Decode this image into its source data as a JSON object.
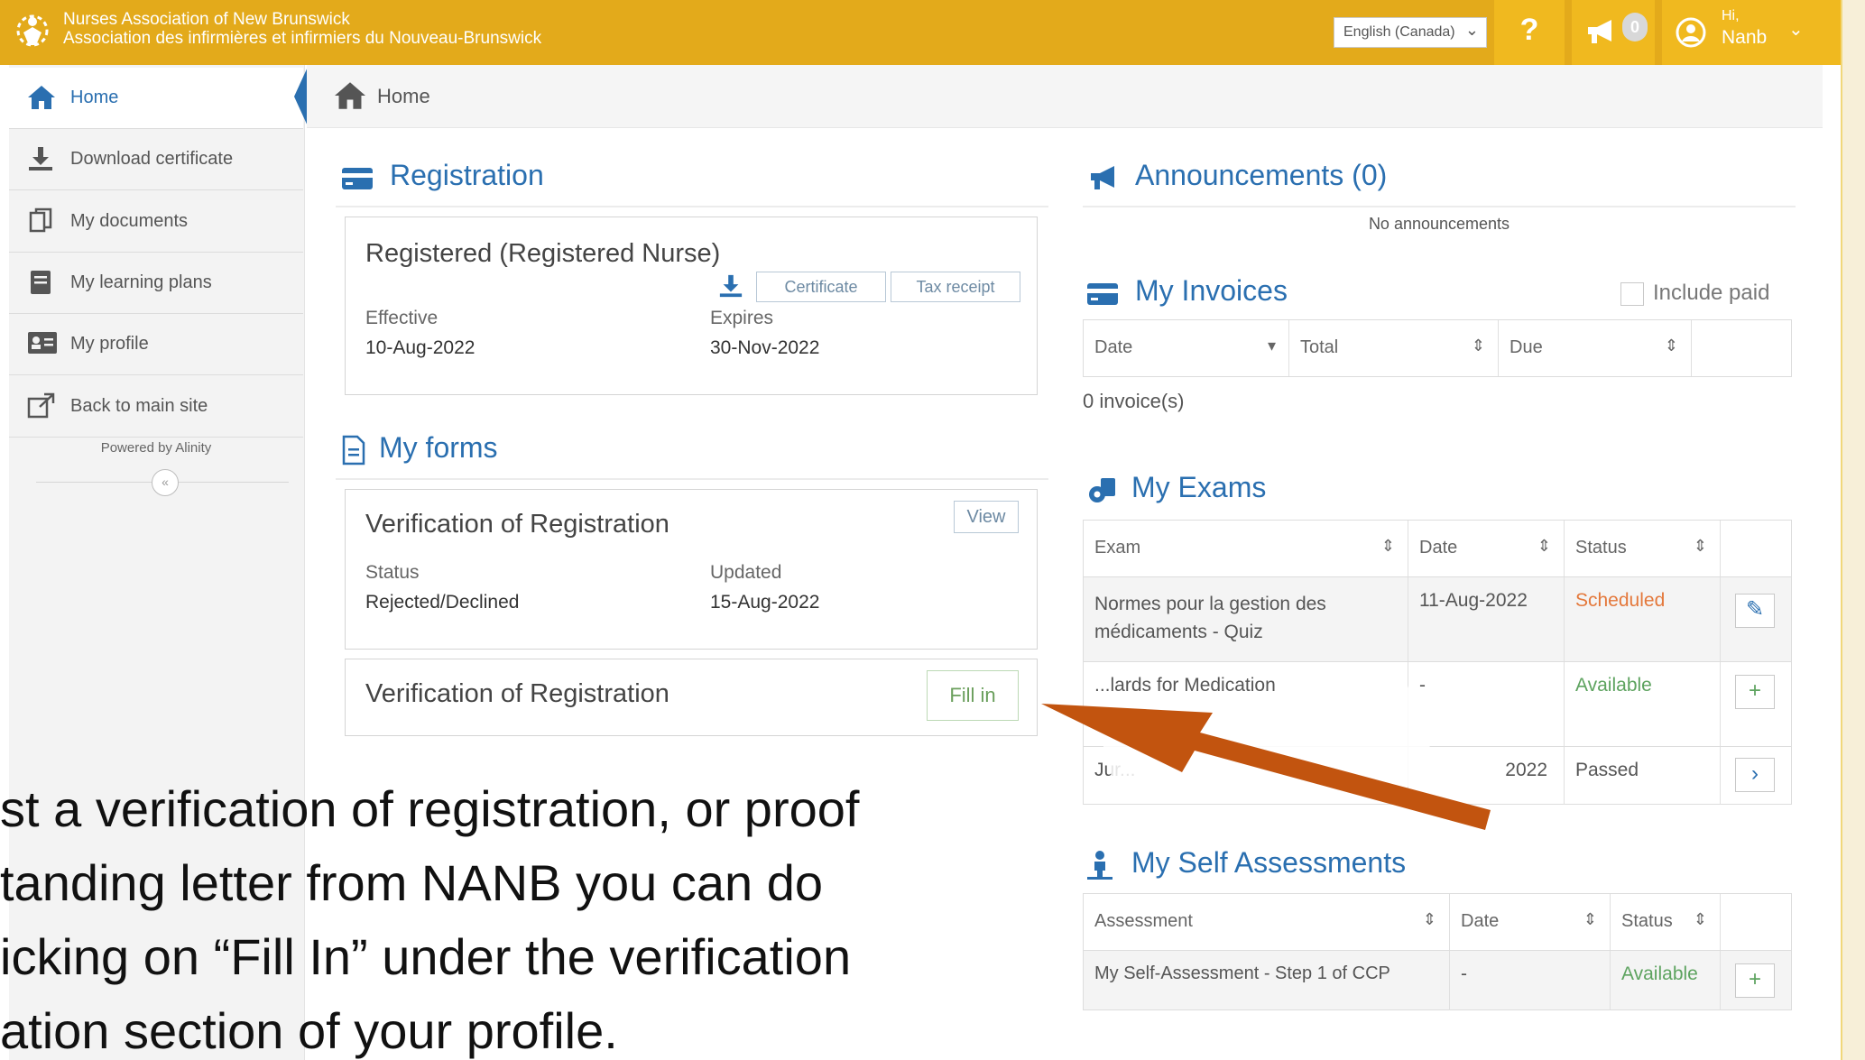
{
  "topbar": {
    "org_name_en": "Nurses Association of New Brunswick",
    "org_name_fr": "Association des infirmières et infirmiers du Nouveau-Brunswick",
    "language": "English (Canada)",
    "help_label": "?",
    "announcement_count": "0",
    "user_greeting": "Hi,",
    "user_name": "Nanb",
    "accent_color": "#e3aa1b"
  },
  "sidebar": {
    "items": [
      {
        "label": "Home",
        "icon": "home-icon"
      },
      {
        "label": "Download certificate",
        "icon": "download-icon"
      },
      {
        "label": "My documents",
        "icon": "documents-icon"
      },
      {
        "label": "My learning plans",
        "icon": "learning-plans-icon"
      },
      {
        "label": "My profile",
        "icon": "profile-card-icon"
      },
      {
        "label": "Back to main site",
        "icon": "external-link-icon"
      }
    ],
    "powered_by": "Powered by Alinity",
    "collapse_label": "«"
  },
  "breadcrumb": {
    "label": "Home"
  },
  "registration": {
    "heading": "Registration",
    "status_title": "Registered (Registered Nurse)",
    "certificate_button": "Certificate",
    "tax_receipt_button": "Tax receipt",
    "effective_label": "Effective",
    "effective_value": "10-Aug-2022",
    "expires_label": "Expires",
    "expires_value": "30-Nov-2022"
  },
  "forms": {
    "heading": "My forms",
    "items": [
      {
        "title": "Verification of Registration",
        "button": "View",
        "status_label": "Status",
        "status_value": "Rejected/Declined",
        "updated_label": "Updated",
        "updated_value": "15-Aug-2022"
      },
      {
        "title": "Verification of Registration",
        "button": "Fill in"
      }
    ]
  },
  "announcements": {
    "heading": "Announcements (0)",
    "empty_text": "No announcements"
  },
  "invoices": {
    "heading": "My Invoices",
    "include_paid_label": "Include paid",
    "columns": [
      "Date",
      "Total",
      "Due"
    ],
    "count_text": "0 invoice(s)"
  },
  "exams": {
    "heading": "My Exams",
    "columns": [
      "Exam",
      "Date",
      "Status"
    ],
    "rows": [
      {
        "exam_line1": "Normes pour la gestion des",
        "exam_line2": "médicaments - Quiz",
        "date": "11-Aug-2022",
        "status": "Scheduled",
        "action": "edit"
      },
      {
        "exam_line1": "...lards for Medication",
        "exam_line2": "",
        "date": "-",
        "status": "Available",
        "action": "add"
      },
      {
        "exam_line1": "Jur...",
        "exam_line2": "",
        "date": "2022",
        "status": "Passed",
        "action": "go"
      }
    ]
  },
  "self_assessments": {
    "heading": "My Self Assessments",
    "columns": [
      "Assessment",
      "Date",
      "Status"
    ],
    "rows": [
      {
        "assessment": "My Self-Assessment - Step 1 of CCP",
        "date": "-",
        "status": "Available",
        "action": "add"
      }
    ]
  },
  "callout": {
    "lines": [
      "st a verification of registration, or proof",
      "tanding letter from NANB you can do",
      "icking on “Fill In” under the verification",
      "ation section of your profile."
    ],
    "arrow_color": "#c2540f"
  }
}
